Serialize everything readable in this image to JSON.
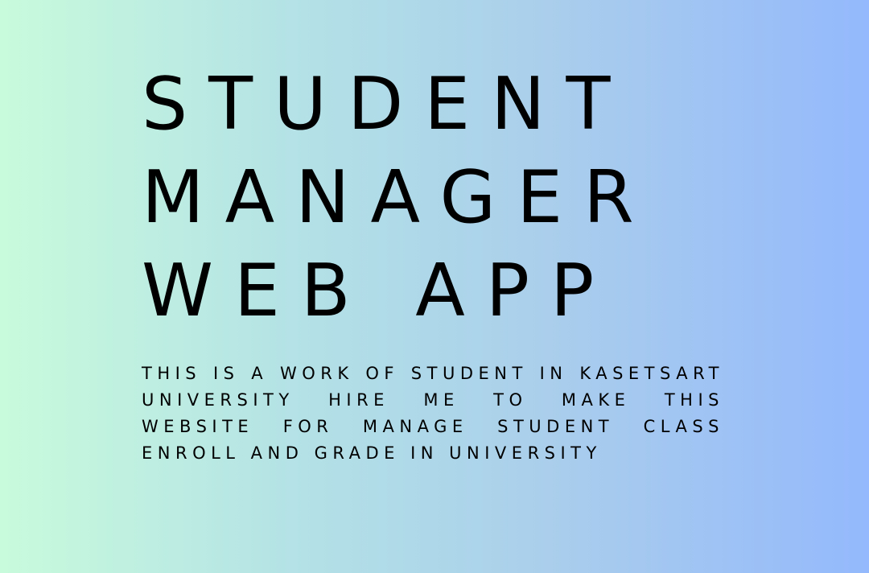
{
  "title": {
    "lines": [
      "STUDENT",
      "MANAGER",
      "WEB APP"
    ]
  },
  "description": "THIS IS A WORK OF STUDENT IN KASETSART UNIVERSITY HIRE ME TO MAKE THIS WEBSITE FOR MANAGE STUDENT CLASS ENROLL AND GRADE IN UNIVERSITY",
  "colors": {
    "gradient_start": "#c8fbdc",
    "gradient_end": "#94b9fc",
    "text": "#000000"
  }
}
